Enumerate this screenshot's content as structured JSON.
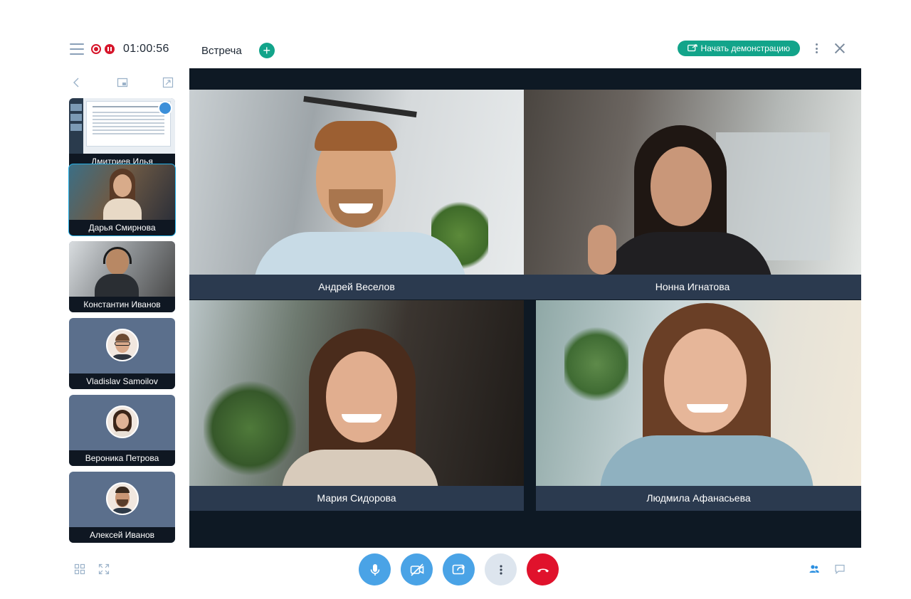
{
  "header": {
    "timer": "01:00:56",
    "meeting_title": "Встреча",
    "demo_button": "Начать демонстрацию"
  },
  "sidebar": {
    "tiles": [
      {
        "name": "Дмитриев Илья",
        "kind": "screen"
      },
      {
        "name": "Дарья Смирнова",
        "kind": "video",
        "active": true
      },
      {
        "name": "Константин Иванов",
        "kind": "video"
      },
      {
        "name": "Vladislav Samoilov",
        "kind": "avatar"
      },
      {
        "name": "Вероника Петрова",
        "kind": "avatar"
      },
      {
        "name": "Алексей Иванов",
        "kind": "avatar"
      }
    ]
  },
  "main": {
    "participants": [
      {
        "name": "Андрей Веселов"
      },
      {
        "name": "Нонна Игнатова"
      },
      {
        "name": "Мария Сидорова"
      },
      {
        "name": "Людмила Афанасьева"
      }
    ]
  },
  "controls": {
    "icons": [
      "microphone-icon",
      "camera-off-icon",
      "share-screen-icon",
      "more-icon",
      "hang-up-icon"
    ]
  },
  "colors": {
    "accent_green": "#12a48a",
    "accent_blue": "#4aa3e6",
    "hangup_red": "#e0122c",
    "stage_bg": "#0e1924",
    "name_bar": "#2b3a4f"
  }
}
